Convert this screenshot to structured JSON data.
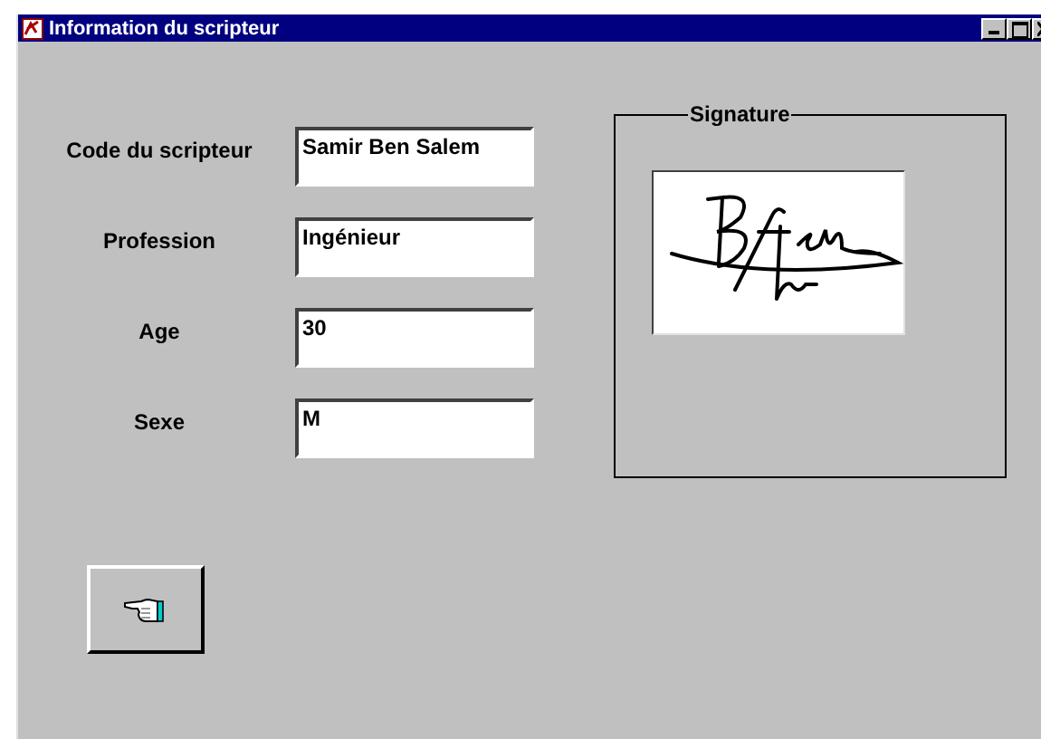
{
  "window": {
    "title": "Information du scripteur"
  },
  "fields": [
    {
      "label": "Code du scripteur",
      "value": "Samir Ben Salem"
    },
    {
      "label": "Profession",
      "value": "Ingénieur"
    },
    {
      "label": "Age",
      "value": "30"
    },
    {
      "label": "Sexe",
      "value": "M"
    }
  ],
  "signature": {
    "title": "Signature"
  }
}
